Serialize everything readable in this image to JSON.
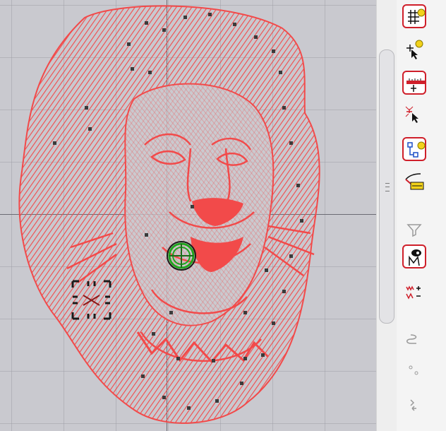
{
  "colors": {
    "canvas_bg": "#c9c9cf",
    "stitch": "#f24a4a",
    "stitch_node": "#3b3b3b",
    "axis": "#6b6b73",
    "target_ring": "#1fa61f",
    "toolbar_bg": "#f4f4f4",
    "tool_border": "#cf1f2a"
  },
  "design": {
    "subject_icon": "lion-head-embroidery",
    "needle_marker": "needle-position-crosshair",
    "selection_marker": "selection-focus-handle"
  },
  "toolbar": {
    "tools": [
      {
        "icon": "grid-settings-icon",
        "boxed": true
      },
      {
        "icon": "snap-point-icon",
        "boxed": false
      },
      {
        "icon": "measure-ruler-icon",
        "boxed": true
      },
      {
        "icon": "select-stitch-icon",
        "boxed": false
      },
      {
        "icon": "node-align-icon",
        "boxed": true
      },
      {
        "icon": "curve-edit-icon",
        "boxed": false
      },
      {
        "icon": "filter-icon",
        "boxed": false
      },
      {
        "icon": "view-object-icon",
        "boxed": true
      },
      {
        "icon": "density-adjust-icon",
        "boxed": false
      },
      {
        "icon": "link-icon",
        "boxed": false
      },
      {
        "icon": "point-dots-icon",
        "boxed": false
      },
      {
        "icon": "travel-path-icon",
        "boxed": false
      }
    ]
  }
}
